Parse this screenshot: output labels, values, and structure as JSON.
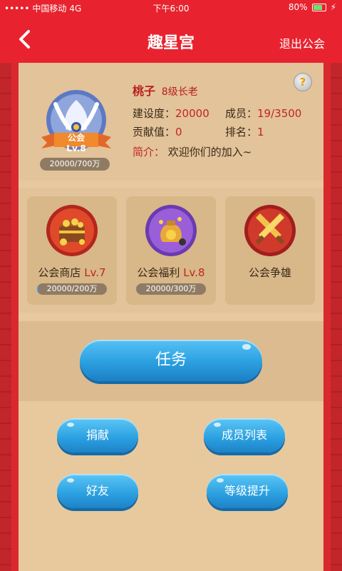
{
  "status_bar": {
    "carrier": "中国移动",
    "network": "4G",
    "time": "下午6:00",
    "battery": "80%",
    "battery_level": 0.8
  },
  "header": {
    "title": "趣星宫",
    "exit_label": "退出公会"
  },
  "guild": {
    "emblem_level": "公会 Lv.8",
    "emblem_exp": "20000/700万",
    "name": "桃子",
    "rank_title": "8级长老",
    "construction_label": "建设度：",
    "construction_value": "20000",
    "members_label": "成员：",
    "members_value": "19/3500",
    "contribution_label": "贡献值：",
    "contribution_value": "0",
    "ranking_label": "排名：",
    "ranking_value": "1",
    "intro_label": "简介：",
    "intro_value": "欢迎你们的加入~"
  },
  "features": [
    {
      "name": "公会商店",
      "level": "Lv.7",
      "progress": "20000/200万",
      "progress_ratio": 0.01,
      "icon": "treasure-chest-icon"
    },
    {
      "name": "公会福利",
      "level": "Lv.8",
      "progress": "20000/300万",
      "progress_ratio": 0.0067,
      "icon": "money-bag-icon"
    },
    {
      "name": "公会争雄",
      "icon": "crossed-swords-icon"
    }
  ],
  "buttons": {
    "task": "任务",
    "donate": "捐献",
    "members": "成员列表",
    "friends": "好友",
    "upgrade": "等级提升"
  }
}
